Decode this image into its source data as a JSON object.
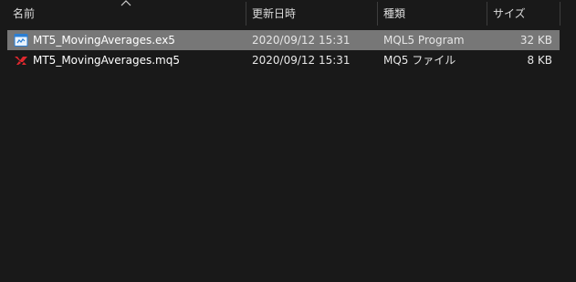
{
  "columns": {
    "name": "名前",
    "modified": "更新日時",
    "type": "種類",
    "size": "サイズ"
  },
  "sort": {
    "column": "name",
    "icon": "sort-up-chevron-icon"
  },
  "files": [
    {
      "name": "MT5_MovingAverages.ex5",
      "modified": "2020/09/12 15:31",
      "type": "MQL5 Program",
      "size": "32 KB",
      "icon": "mql5-program-icon",
      "selected": true
    },
    {
      "name": "MT5_MovingAverages.mq5",
      "modified": "2020/09/12 15:31",
      "type": "MQ5 ファイル",
      "size": "8 KB",
      "icon": "mq5-source-icon",
      "selected": false
    }
  ],
  "colors": {
    "background": "#191919",
    "selection": "#777777",
    "separator": "#3d3d3d",
    "mq5_icon_red": "#e0282e",
    "ex5_icon_blue": "#2a7fd4"
  }
}
